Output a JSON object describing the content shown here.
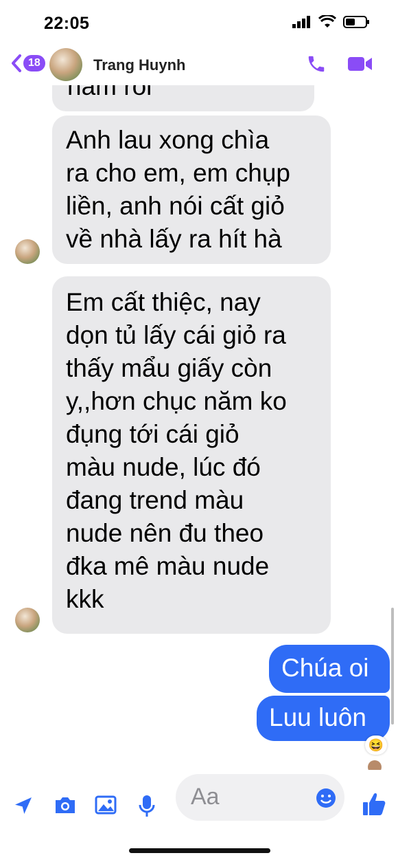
{
  "status": {
    "time": "22:05"
  },
  "header": {
    "back_count": "18",
    "contact_name": "Trang Huynh"
  },
  "messages": [
    {
      "side": "in",
      "lines": [
        "năm rồi"
      ]
    },
    {
      "side": "in",
      "lines": [
        "Anh lau xong chìa",
        "ra cho em, em chụp",
        "liền, anh nói cất giỏ",
        "về nhà lấy ra hít hà"
      ]
    },
    {
      "side": "in",
      "lines": [
        "Em cất thiệc, nay",
        "dọn tủ lấy cái giỏ ra",
        "thấy mẩu giấy còn",
        "y,,hơn chục năm ko",
        "đụng tới cái giỏ",
        "màu nude, lúc đó",
        "đang trend màu",
        "nude nên đu theo",
        "đka mê màu nude",
        "kkk"
      ]
    },
    {
      "side": "out",
      "lines": [
        "Chúa oi"
      ]
    },
    {
      "side": "out",
      "lines": [
        "Luu luôn"
      ]
    }
  ],
  "reaction": "😆",
  "composer": {
    "placeholder": "Aa"
  },
  "colors": {
    "accent": "#8a4cf6",
    "outgoing": "#2f6cf6",
    "incoming": "#e9e9eb"
  }
}
